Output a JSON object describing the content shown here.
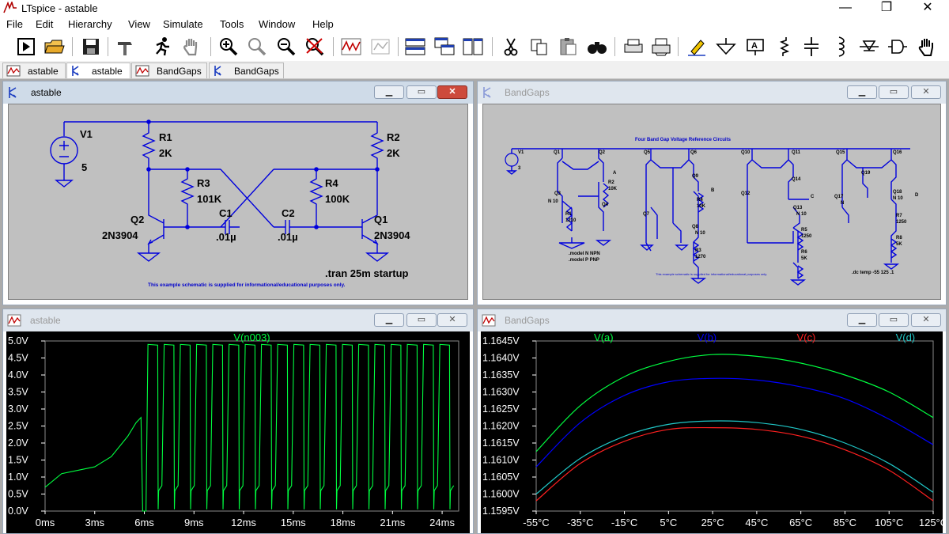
{
  "window": {
    "title": "LTspice - astable",
    "controls": {
      "minimize": "—",
      "maximize": "❐",
      "close": "✕"
    }
  },
  "menu": [
    "File",
    "Edit",
    "Hierarchy",
    "View",
    "Simulate",
    "Tools",
    "Window",
    "Help"
  ],
  "toolbar": {
    "buttons": [
      "run-icon",
      "open-icon",
      "save-icon",
      "hammer-icon",
      "running-man-icon",
      "pan-hand-icon",
      "zoom-in-icon",
      "zoom-out-icon",
      "zoom-fit-icon",
      "zoom-cancel-icon",
      "waveform-icon",
      "autorange-icon",
      "tile-horizontal-icon",
      "cascade-icon",
      "tile-vertical-icon",
      "cut-icon",
      "copy-icon",
      "paste-icon",
      "find-icon",
      "print-setup-icon",
      "print-icon",
      "draw-wire-icon",
      "ground-icon",
      "label-net-icon",
      "resistor-icon",
      "capacitor-icon",
      "inductor-icon",
      "diode-icon",
      "component-icon",
      "move-hand-icon"
    ]
  },
  "tabs": [
    {
      "label": "astable",
      "kind": "waveform"
    },
    {
      "label": "astable",
      "kind": "schematic",
      "active": true
    },
    {
      "label": "BandGaps",
      "kind": "waveform"
    },
    {
      "label": "BandGaps",
      "kind": "schematic"
    }
  ],
  "windows": {
    "astable_schematic": {
      "title": "astable",
      "labels": {
        "v1": "V1",
        "v1_value": "5",
        "r1": "R1",
        "r1_value": "2K",
        "r2": "R2",
        "r2_value": "2K",
        "r3": "R3",
        "r3_value": "101K",
        "r4": "R4",
        "r4_value": "100K",
        "c1": "C1",
        "c1_value": ".01µ",
        "c2": "C2",
        "c2_value": ".01µ",
        "q1": "Q1",
        "q1_value": "2N3904",
        "q2": "Q2",
        "q2_value": "2N3904",
        "directive": ".tran 25m startup",
        "note": "This example schematic is supplied for informational/educational purposes only."
      }
    },
    "bandgaps_schematic": {
      "title": "BandGaps",
      "labels": {
        "heading": "Four Band Gap Voltage Reference Circuits",
        "model_npn": ".model N NPN",
        "model_pnp": ".model P PNP",
        "directive": ".dc temp -55 125 .1",
        "note": "This example schematic is supplied for informational/educational purposes only.",
        "v1": "V1",
        "v1_value": "3"
      }
    },
    "astable_plot": {
      "title": "astable",
      "trace_label": "V(n003)",
      "trace_color": "#00ff40"
    },
    "bandgaps_plot": {
      "title": "BandGaps"
    }
  },
  "chart_data": [
    {
      "type": "line",
      "title": "",
      "xlabel": "",
      "ylabel": "",
      "xlim": [
        0,
        25
      ],
      "ylim": [
        0,
        5
      ],
      "x_ticks": [
        "0ms",
        "3ms",
        "6ms",
        "9ms",
        "12ms",
        "15ms",
        "18ms",
        "21ms",
        "24ms"
      ],
      "y_ticks": [
        "0.0V",
        "0.5V",
        "1.0V",
        "1.5V",
        "2.0V",
        "2.5V",
        "3.0V",
        "3.5V",
        "4.0V",
        "4.5V",
        "5.0V"
      ],
      "series": [
        {
          "name": "V(n003)",
          "color": "#00ff40",
          "x": [
            0,
            1,
            2,
            3,
            4,
            5,
            5.5,
            5.8,
            5.9,
            6.1,
            6.2,
            6.3,
            25
          ],
          "y": [
            0.7,
            1.1,
            1.2,
            1.3,
            1.6,
            2.2,
            2.6,
            2.75,
            0.0,
            0.0,
            4.9,
            4.9,
            4.9
          ]
        }
      ],
      "notes": "After startup (~6ms) the waveform oscillates between 0V and 4.9V with period ≈1.0ms."
    },
    {
      "type": "line",
      "title": "",
      "xlabel": "",
      "ylabel": "",
      "xlim": [
        -55,
        125
      ],
      "ylim": [
        1.1595,
        1.1645
      ],
      "x_ticks": [
        "-55°C",
        "-35°C",
        "-15°C",
        "5°C",
        "25°C",
        "45°C",
        "65°C",
        "85°C",
        "105°C",
        "125°C"
      ],
      "y_ticks": [
        "1.1595V",
        "1.1600V",
        "1.1605V",
        "1.1610V",
        "1.1615V",
        "1.1620V",
        "1.1625V",
        "1.1630V",
        "1.1635V",
        "1.1640V",
        "1.1645V"
      ],
      "series": [
        {
          "name": "V(a)",
          "color": "#00ff40",
          "x": [
            -55,
            -35,
            -15,
            5,
            25,
            45,
            65,
            85,
            105,
            125
          ],
          "y": [
            1.16125,
            1.1626,
            1.16345,
            1.1639,
            1.1641,
            1.16405,
            1.16385,
            1.1635,
            1.163,
            1.16225
          ]
        },
        {
          "name": "V(b)",
          "color": "#0000ff",
          "x": [
            -55,
            -35,
            -15,
            5,
            25,
            45,
            65,
            85,
            105,
            125
          ],
          "y": [
            1.1608,
            1.1621,
            1.1629,
            1.1633,
            1.1634,
            1.16335,
            1.16315,
            1.1628,
            1.1622,
            1.16145
          ]
        },
        {
          "name": "V(c)",
          "color": "#ff2020",
          "x": [
            -55,
            -35,
            -15,
            5,
            25,
            45,
            65,
            85,
            105,
            125
          ],
          "y": [
            1.1598,
            1.1609,
            1.16155,
            1.1619,
            1.16195,
            1.1619,
            1.1617,
            1.1613,
            1.1607,
            1.1598
          ]
        },
        {
          "name": "V(d)",
          "color": "#20c8c8",
          "x": [
            -55,
            -35,
            -15,
            5,
            25,
            45,
            65,
            85,
            105,
            125
          ],
          "y": [
            1.16,
            1.16105,
            1.1617,
            1.16205,
            1.16215,
            1.1621,
            1.1619,
            1.1615,
            1.1609,
            1.16005
          ]
        }
      ]
    }
  ]
}
